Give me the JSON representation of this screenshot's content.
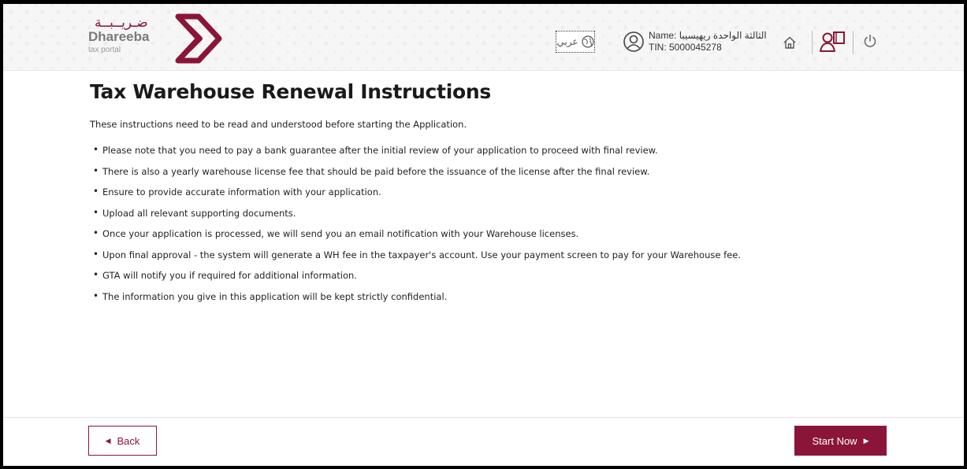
{
  "brand": {
    "arabic_name": "ضـريــبــة",
    "name": "Dhareeba",
    "subtitle": "tax portal",
    "color": "#8a1538"
  },
  "header": {
    "language_label": "عربي",
    "user_name": "Name: الثالثة الواحدة ريهيسيبا",
    "tin": "TIN: 5000045278",
    "icons": [
      "globe-icon",
      "user-circle-icon",
      "home-icon",
      "profile-switch-icon",
      "power-icon"
    ]
  },
  "page": {
    "title": "Tax Warehouse Renewal Instructions",
    "intro": "These instructions need to be read and understood before starting the Application.",
    "instructions": [
      "Please note that you need to pay a bank guarantee after the initial review of your application to proceed with final review.",
      "There is also a yearly warehouse license fee that should be paid before the issuance of the license after the final review.",
      "Ensure to provide accurate information with your application.",
      "Upload all relevant supporting documents.",
      "Once your application is processed, we will send you an email notification with your Warehouse licenses.",
      "Upon final approval - the system will generate a WH fee in the taxpayer's account. Use your payment screen to pay for your Warehouse fee.",
      "GTA will notify you if required for additional information.",
      "The information you give in this application will be kept strictly confidential."
    ]
  },
  "footer": {
    "back_label": "Back",
    "start_label": "Start Now"
  }
}
